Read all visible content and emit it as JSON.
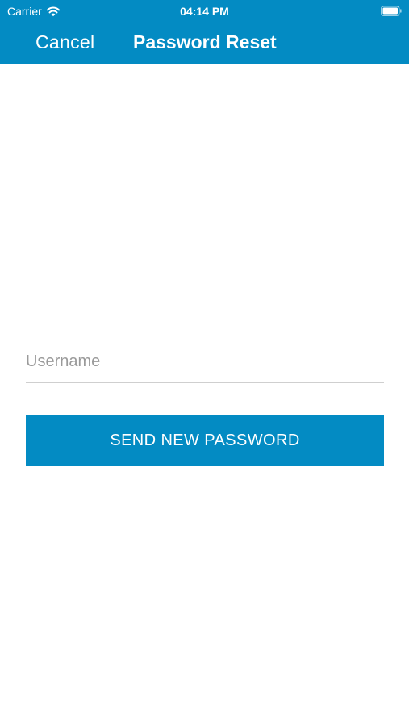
{
  "status_bar": {
    "carrier": "Carrier",
    "time": "04:14 PM",
    "wifi_icon": "wifi-icon",
    "battery_icon": "battery-full-icon"
  },
  "nav_bar": {
    "cancel_label": "Cancel",
    "title": "Password Reset"
  },
  "form": {
    "username": {
      "value": "",
      "placeholder": "Username"
    },
    "submit_label": "SEND NEW PASSWORD"
  },
  "colors": {
    "accent": "#038bc3",
    "background": "#ffffff",
    "divider": "#cfcfcf",
    "placeholder": "#9a9a9a"
  }
}
